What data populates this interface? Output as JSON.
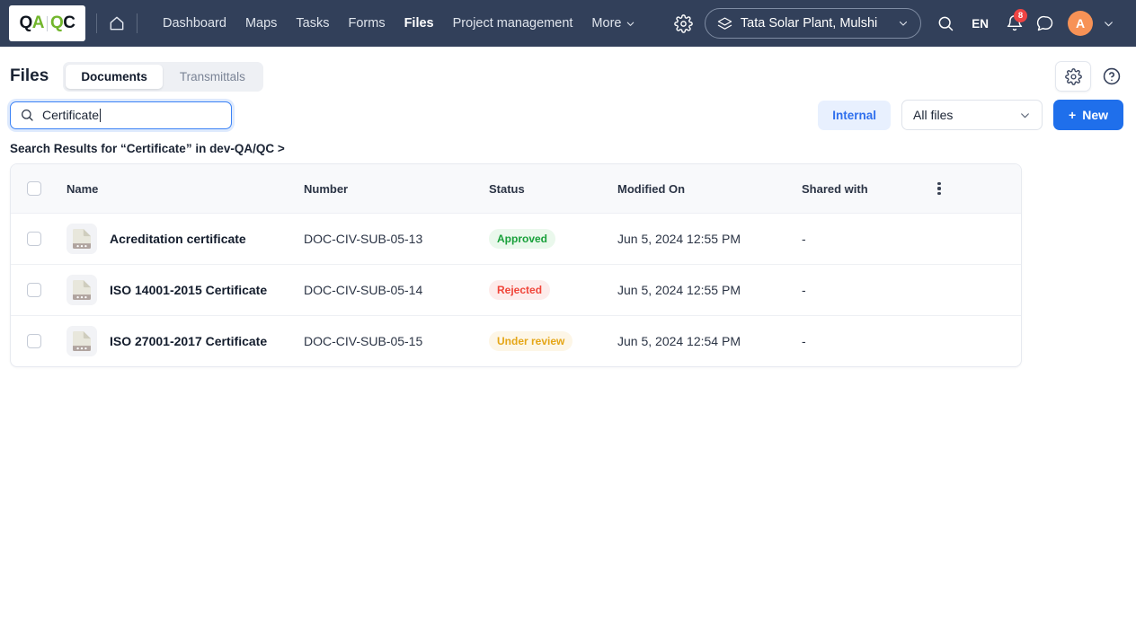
{
  "topbar": {
    "logo": {
      "q1": "Q",
      "a": "A",
      "q2": "Q",
      "c": "C"
    },
    "home_label": "Home",
    "nav": [
      {
        "label": "Dashboard",
        "active": false
      },
      {
        "label": "Maps",
        "active": false
      },
      {
        "label": "Tasks",
        "active": false
      },
      {
        "label": "Forms",
        "active": false
      },
      {
        "label": "Files",
        "active": true
      },
      {
        "label": "Project management",
        "active": false
      }
    ],
    "more_label": "More",
    "project": "Tata Solar Plant, Mulshi",
    "language": "EN",
    "notification_count": "8",
    "avatar_initial": "A"
  },
  "subheader": {
    "title": "Files",
    "tabs": [
      {
        "label": "Documents",
        "active": true
      },
      {
        "label": "Transmittals",
        "active": false
      }
    ]
  },
  "search": {
    "value": "Certificate",
    "placeholder": "Search"
  },
  "filters": {
    "internal_label": "Internal",
    "file_scope": "All files",
    "new_button": "New",
    "new_icon": "+"
  },
  "results": {
    "label": "Search Results for “Certificate” in dev-QA/QC >"
  },
  "table": {
    "columns": [
      "Name",
      "Number",
      "Status",
      "Modified On",
      "Shared with"
    ],
    "rows": [
      {
        "name": "Acreditation certificate",
        "number": "DOC-CIV-SUB-05-13",
        "status": "Approved",
        "status_color": "#18a03a",
        "status_bg": "#eaf8ec",
        "modified": "Jun 5, 2024 12:55 PM",
        "shared": "-"
      },
      {
        "name": "ISO 14001-2015 Certificate",
        "number": "DOC-CIV-SUB-05-14",
        "status": "Rejected",
        "status_color": "#f0453a",
        "status_bg": "#fdeceb",
        "modified": "Jun 5, 2024 12:55 PM",
        "shared": "-"
      },
      {
        "name": "ISO 27001-2017 Certificate",
        "number": "DOC-CIV-SUB-05-15",
        "status": "Under review",
        "status_color": "#e5a617",
        "status_bg": "#fdf6e7",
        "modified": "Jun 5, 2024 12:54 PM",
        "shared": "-"
      }
    ]
  },
  "colors": {
    "topbar_bg": "#32405a",
    "accent_blue": "#1f6feb",
    "logo_green": "#72b62c",
    "avatar_orange": "#f79256",
    "badge_red": "#ef4444"
  }
}
